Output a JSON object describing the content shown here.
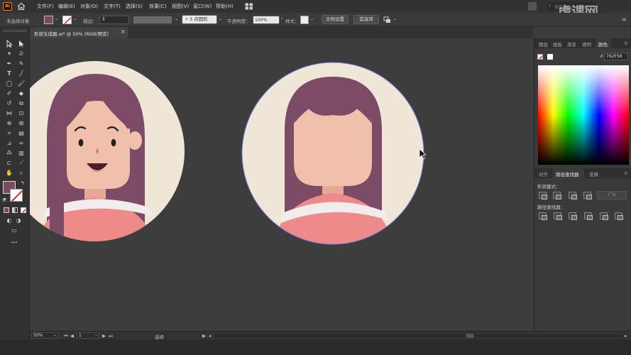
{
  "app": {
    "logo": "Ai",
    "home_icon": "home-icon"
  },
  "menu": [
    "文件(F)",
    "编辑(E)",
    "对象(O)",
    "文字(T)",
    "选择(S)",
    "效果(C)",
    "视图(V)",
    "窗口(W)",
    "帮助(H)"
  ],
  "search": {
    "placeholder": "搜索 Adobe 脚本"
  },
  "watermark": "虎课网",
  "control_bar": {
    "no_selection": "未选择对象",
    "stroke_label": "描边：",
    "brush_value": "3 点圆形",
    "opacity_label": "不透明度：",
    "opacity_value": "100%",
    "style_label": "样式：",
    "doc_setup": "文档设置",
    "preferences": "首选项"
  },
  "document": {
    "tab_title": "形状生成器.ai* @ 50% (RGB/预览)",
    "close": "×"
  },
  "colors": {
    "fill": "#7a4a63",
    "hair": "#7c4b66",
    "face": "#f0c0ac",
    "bg_circle": "#efe6d8",
    "shirt": "#ef8a8a",
    "stripe": "#f3ecec"
  },
  "right_panel": {
    "top_tabs": [
      "图层",
      "画板",
      "渐变",
      "透明",
      "颜色"
    ],
    "hex_value": "762F58",
    "bottom_tabs": [
      "对齐",
      "路径查找器",
      "变换"
    ],
    "shape_modes_label": "形状模式：",
    "expand_button": "扩展",
    "pathfinder_label": "路径查找器："
  },
  "status_bar": {
    "zoom": "50%",
    "artboard": "1",
    "tool": "选择"
  }
}
